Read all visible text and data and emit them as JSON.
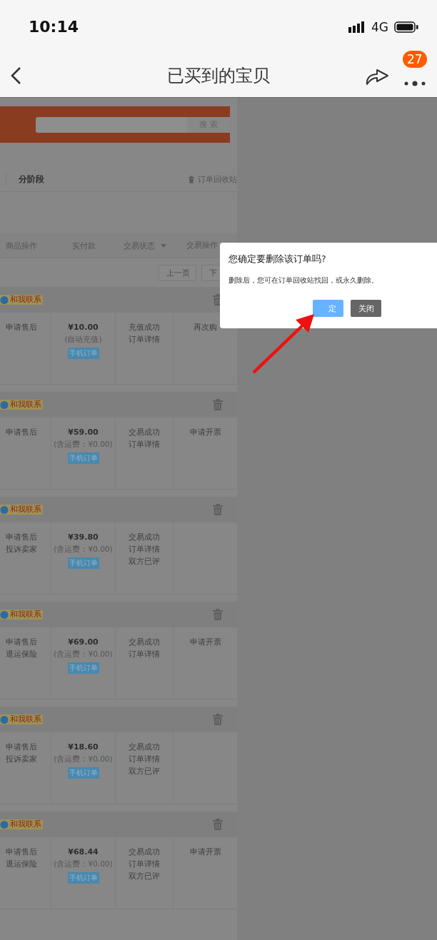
{
  "status_bar": {
    "time": "10:14",
    "network": "4G"
  },
  "nav": {
    "title": "已买到的宝贝",
    "badge": "27"
  },
  "search": {
    "button": "搜 索"
  },
  "tabs": [
    {
      "label": "分阶段",
      "selected": true
    }
  ],
  "recycle_bin": "订单回收站",
  "columns": [
    {
      "label": "商品操作",
      "sortable": false
    },
    {
      "label": "实付款",
      "sortable": false
    },
    {
      "label": "交易状态",
      "sortable": true
    },
    {
      "label": "交易操作"
    }
  ],
  "pagination": [
    "上一页",
    "下"
  ],
  "orders": [
    {
      "contact": "和我联系",
      "item_actions": [
        "申请售后"
      ],
      "price": "¥10.00",
      "price_note": "(自动充值)",
      "tag": "手机订单",
      "status": [
        "充值成功",
        "订单详情"
      ],
      "actions": [
        "再次购"
      ]
    },
    {
      "contact": "和我联系",
      "item_actions": [
        "申请售后"
      ],
      "price": "¥59.00",
      "price_note": "(含运费：¥0.00)",
      "tag": "手机订单",
      "status": [
        "交易成功",
        "订单详情"
      ],
      "actions": [
        "申请开票"
      ]
    },
    {
      "contact": "和我联系",
      "item_actions": [
        "申请售后",
        "投诉卖家"
      ],
      "price": "¥39.80",
      "price_note": "(含运费：¥0.00)",
      "tag": "手机订单",
      "status": [
        "交易成功",
        "订单详情",
        "双方已评"
      ]
    },
    {
      "contact": "和我联系",
      "item_actions": [
        "申请售后",
        "退运保险"
      ],
      "price": "¥69.00",
      "price_note": "(含运费：¥0.00)",
      "tag": "手机订单",
      "status": [
        "交易成功",
        "订单详情"
      ],
      "actions": [
        "申请开票"
      ]
    },
    {
      "contact": "和我联系",
      "item_actions": [
        "申请售后",
        "投诉卖家"
      ],
      "price": "¥18.60",
      "price_note": "(含运费：¥0.00)",
      "tag": "手机订单",
      "status": [
        "交易成功",
        "订单详情",
        "双方已评"
      ]
    },
    {
      "contact": "和我联系",
      "item_actions": [
        "申请售后",
        "退运保险"
      ],
      "price": "¥68.44",
      "price_note": "(含运费：¥0.00)",
      "tag": "手机订单",
      "status": [
        "交易成功",
        "订单详情",
        "双方已评"
      ],
      "actions": [
        "申请开票"
      ]
    }
  ],
  "dialog": {
    "title": "您确定要删除该订单吗?",
    "message": "删除后，您可在订单回收站找回，或永久删除。",
    "buttons": [
      {
        "label": "定",
        "kind": "primary"
      },
      {
        "label": "关闭",
        "kind": "secondary"
      }
    ]
  }
}
